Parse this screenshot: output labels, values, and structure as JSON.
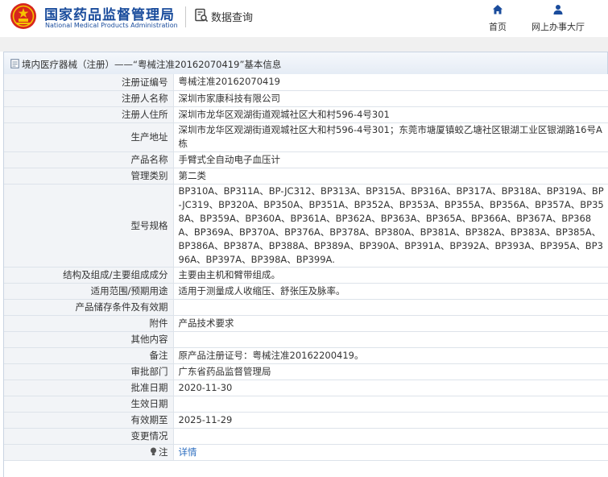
{
  "header": {
    "org_name_cn": "国家药品监督管理局",
    "org_name_en": "National Medical Products Administration",
    "query_label": "数据查询",
    "nav": [
      {
        "label": "首页",
        "icon": "home-icon"
      },
      {
        "label": "网上办事大厅",
        "icon": "user-icon"
      }
    ]
  },
  "title_bar": {
    "text": "境内医疗器械（注册）——“粤械注准20162070419”基本信息"
  },
  "details": {
    "rows": [
      {
        "label": "注册证编号",
        "value": "粤械注准20162070419"
      },
      {
        "label": "注册人名称",
        "value": "深圳市家康科技有限公司"
      },
      {
        "label": "注册人住所",
        "value": "深圳市龙华区观湖街道观城社区大和村596-4号301"
      },
      {
        "label": "生产地址",
        "value": "深圳市龙华区观湖街道观城社区大和村596-4号301；东莞市塘厦镇蛟乙塘社区银湖工业区银湖路16号A栋"
      },
      {
        "label": "产品名称",
        "value": "手臂式全自动电子血压计"
      },
      {
        "label": "管理类别",
        "value": "第二类"
      },
      {
        "label": "型号规格",
        "value": "BP310A、BP311A、BP-JC312、BP313A、BP315A、BP316A、BP317A、BP318A、BP319A、BP-JC319、BP320A、BP350A、BP351A、BP352A、BP353A、BP355A、BP356A、BP357A、BP358A、BP359A、BP360A、BP361A、BP362A、BP363A、BP365A、BP366A、BP367A、BP368A、BP369A、BP370A、BP376A、BP378A、BP380A、BP381A、BP382A、BP383A、BP385A、BP386A、BP387A、BP388A、BP389A、BP390A、BP391A、BP392A、BP393A、BP395A、BP396A、BP397A、BP398A、BP399A."
      },
      {
        "label": "结构及组成/主要组成成分",
        "value": "主要由主机和臂带组成。"
      },
      {
        "label": "适用范围/预期用途",
        "value": "适用于测量成人收缩压、舒张压及脉率。"
      },
      {
        "label": "产品储存条件及有效期",
        "value": ""
      },
      {
        "label": "附件",
        "value": "产品技术要求"
      },
      {
        "label": "其他内容",
        "value": ""
      },
      {
        "label": "备注",
        "value": "原产品注册证号：粤械注准20162200419。"
      },
      {
        "label": "审批部门",
        "value": "广东省药品监督管理局"
      },
      {
        "label": "批准日期",
        "value": "2020-11-30"
      },
      {
        "label": "生效日期",
        "value": ""
      },
      {
        "label": "有效期至",
        "value": "2025-11-29"
      },
      {
        "label": "变更情况",
        "value": ""
      },
      {
        "label": "注",
        "value": "详情"
      }
    ]
  }
}
